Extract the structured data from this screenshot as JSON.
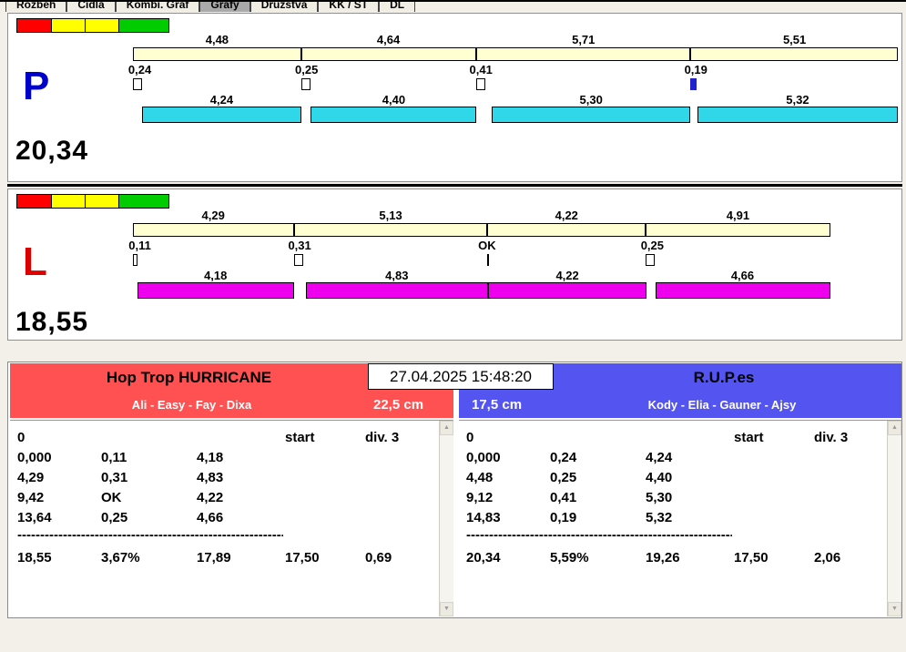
{
  "window": {
    "active_tab": "Grafy"
  },
  "tab_bar": {
    "tabs": [
      {
        "label": "Rozbeh"
      },
      {
        "label": "Cidla"
      },
      {
        "label": "Kombi. Graf"
      },
      {
        "label": "Grafy"
      },
      {
        "label": "Družstva"
      },
      {
        "label": "KK / ST"
      },
      {
        "label": "DL"
      }
    ]
  },
  "clock": {
    "datetime": "27.04.2025 15:48:20"
  },
  "lanes": [
    {
      "letter": "P",
      "total": "20,34",
      "splits": [
        "4,48",
        "4,64",
        "5,71",
        "5,51"
      ],
      "passes": [
        "0,24",
        "0,25",
        "0,41",
        "0,19"
      ],
      "pass_markers": [
        "outline",
        "outline",
        "outline",
        "filled"
      ],
      "runs": [
        "4,24",
        "4,40",
        "5,30",
        "5,32"
      ]
    },
    {
      "letter": "L",
      "total": "18,55",
      "splits": [
        "4,29",
        "5,13",
        "4,22",
        "4,91"
      ],
      "passes": [
        "0,11",
        "0,31",
        "OK",
        "0,25"
      ],
      "pass_markers": [
        "narrow",
        "outline",
        "line",
        "outline"
      ],
      "runs": [
        "4,18",
        "4,83",
        "4,22",
        "4,66"
      ]
    }
  ],
  "teams": [
    {
      "name": "Hop Trop HURRICANE",
      "dogs": "Ali - Easy - Fay - Dixa",
      "jump_height": "22,5 cm",
      "col_zero": "0",
      "col_start": "start",
      "col_div": "div. 3",
      "rows": [
        {
          "cum": "0,000",
          "pass": "0,11",
          "run": "4,18"
        },
        {
          "cum": "4,29",
          "pass": "0,31",
          "run": "4,83"
        },
        {
          "cum": "9,42",
          "pass": "OK",
          "run": "4,22"
        },
        {
          "cum": "13,64",
          "pass": "0,25",
          "run": "4,66"
        }
      ],
      "separator": "--------------------------------------------------------------------",
      "totals": {
        "time": "18,55",
        "pct": "3,67%",
        "sum": "17,89",
        "ref": "17,50",
        "diff": "0,69"
      }
    },
    {
      "name": "R.U.P.es",
      "dogs": "Kody - Elia - Gauner - Ajsy",
      "jump_height": "17,5 cm",
      "col_zero": "0",
      "col_start": "start",
      "col_div": "div. 3",
      "rows": [
        {
          "cum": "0,000",
          "pass": "0,24",
          "run": "4,24"
        },
        {
          "cum": "4,48",
          "pass": "0,25",
          "run": "4,40"
        },
        {
          "cum": "9,12",
          "pass": "0,41",
          "run": "5,30"
        },
        {
          "cum": "14,83",
          "pass": "0,19",
          "run": "5,32"
        }
      ],
      "separator": "--------------------------------------------------------------------",
      "totals": {
        "time": "20,34",
        "pct": "5,59%",
        "sum": "19,26",
        "ref": "17,50",
        "diff": "2,06"
      }
    }
  ],
  "icons": {
    "scroll_up": "▲",
    "scroll_down": "▼"
  },
  "colors": {
    "run_bar_p": "#30d7e8",
    "run_bar_l": "#ee00ee",
    "split_bar": "#ffffd2",
    "team_left": "#ff5151",
    "team_right": "#5454f0",
    "letter_p": "#0000cc",
    "letter_l": "#dd0000",
    "marker_filled": "#2222cc",
    "status_red": "#ff0000",
    "status_yellow": "#ffff00",
    "status_green": "#00cc00"
  }
}
